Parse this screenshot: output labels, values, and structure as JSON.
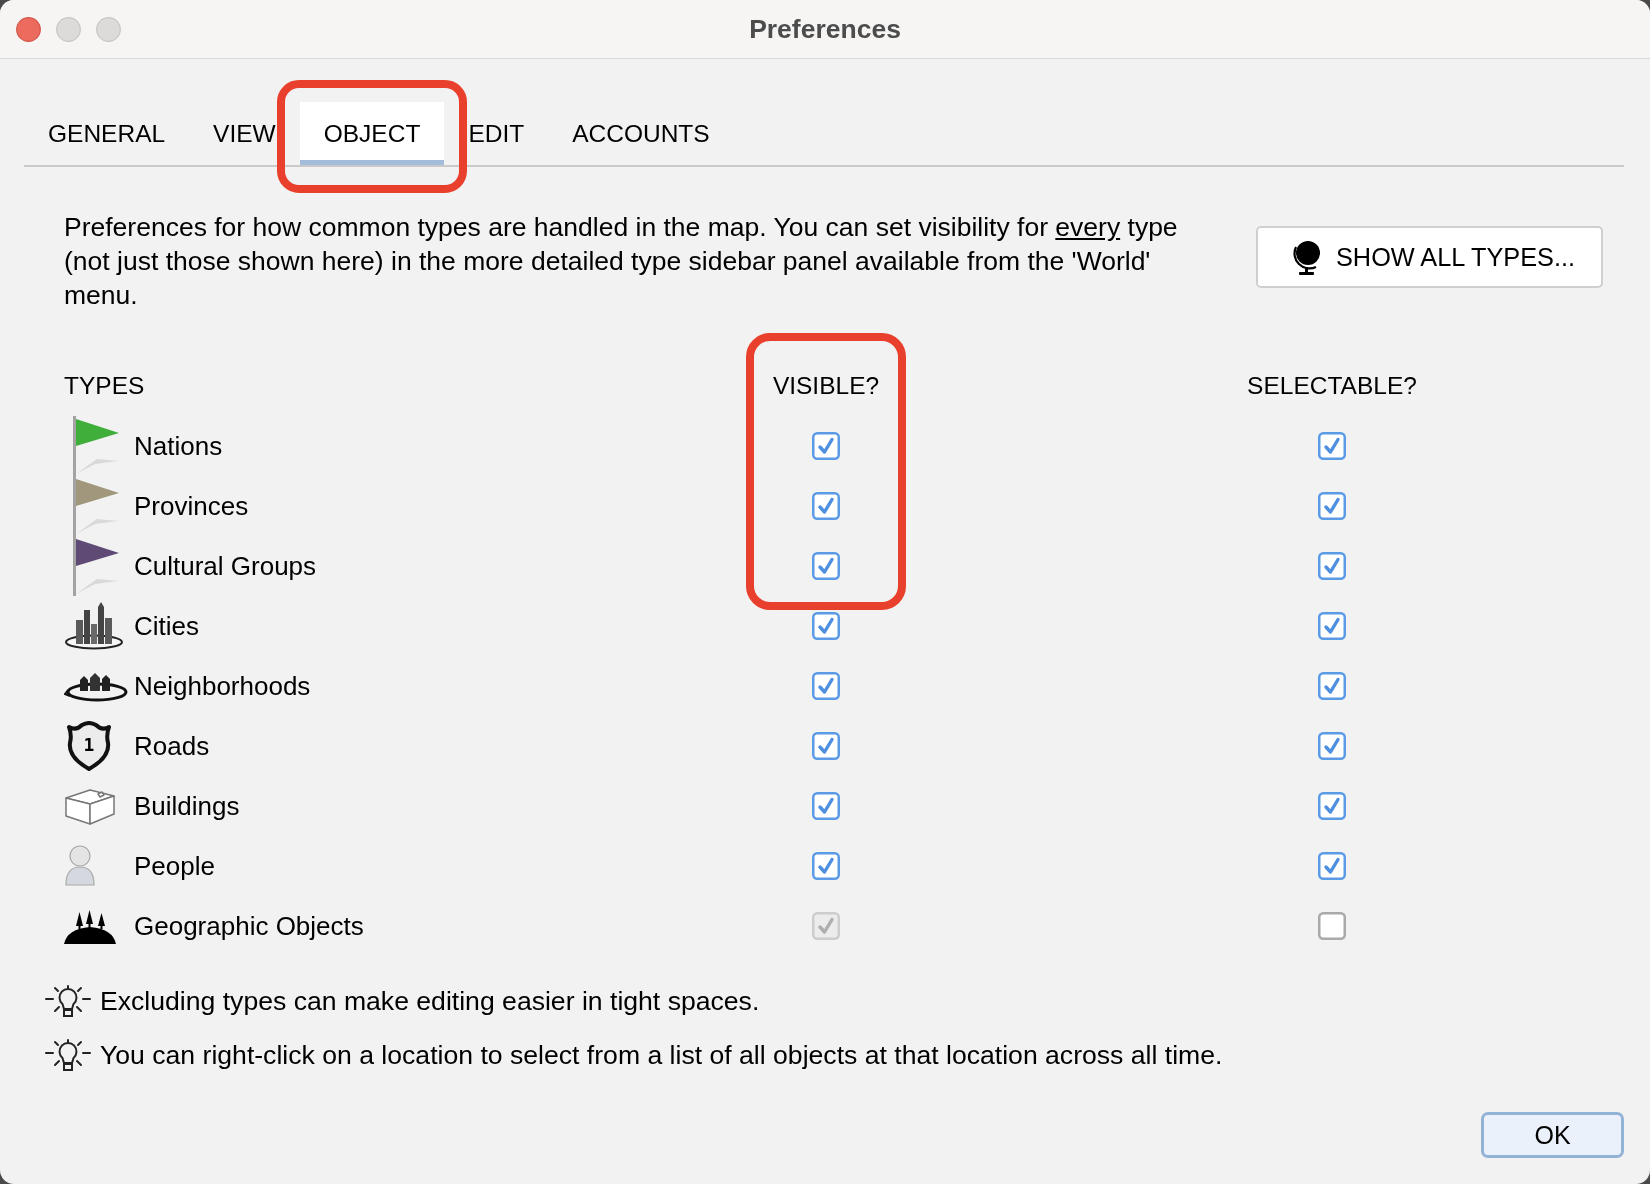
{
  "window": {
    "title": "Preferences",
    "buttons": [
      {
        "kind": "close",
        "disabled": false
      },
      {
        "kind": "minimize",
        "disabled": true
      },
      {
        "kind": "zoom",
        "disabled": true
      }
    ]
  },
  "tabs": [
    {
      "label": "GENERAL",
      "selected": false
    },
    {
      "label": "VIEW",
      "selected": false
    },
    {
      "label": "OBJECT",
      "selected": true,
      "highlighted": true
    },
    {
      "label": "EDIT",
      "selected": false
    },
    {
      "label": "ACCOUNTS",
      "selected": false
    }
  ],
  "description": [
    {
      "text": "Preferences for how common types are handled in the map. You can set visibility for ",
      "underlined": false
    },
    {
      "text": "every",
      "underlined": true
    },
    {
      "text": " type (not just those shown here) in the more detailed type sidebar panel available from the 'World' menu.",
      "underlined": false
    }
  ],
  "show_all_button": {
    "label": "SHOW ALL TYPES..."
  },
  "columns": [
    {
      "label": "TYPES"
    },
    {
      "label": "VISIBLE?",
      "highlighted": true
    },
    {
      "label": "SELECTABLE?"
    }
  ],
  "types": [
    {
      "name": "Nations",
      "kind": "flag",
      "color": "#3fae3a",
      "visible": {
        "checked": true,
        "disabled": false,
        "highlighted": true
      },
      "selectable": {
        "checked": true,
        "disabled": false
      }
    },
    {
      "name": "Provinces",
      "kind": "flag",
      "color": "#a0977c",
      "visible": {
        "checked": true,
        "disabled": false,
        "highlighted": true
      },
      "selectable": {
        "checked": true,
        "disabled": false
      }
    },
    {
      "name": "Cultural Groups",
      "kind": "flag",
      "color": "#5e4a74",
      "visible": {
        "checked": true,
        "disabled": false,
        "highlighted": true
      },
      "selectable": {
        "checked": true,
        "disabled": false
      }
    },
    {
      "name": "Cities",
      "kind": "city",
      "visible": {
        "checked": true,
        "disabled": false
      },
      "selectable": {
        "checked": true,
        "disabled": false
      }
    },
    {
      "name": "Neighborhoods",
      "kind": "neighborhood",
      "visible": {
        "checked": true,
        "disabled": false
      },
      "selectable": {
        "checked": true,
        "disabled": false
      }
    },
    {
      "name": "Roads",
      "kind": "shield",
      "icon_text": "1",
      "visible": {
        "checked": true,
        "disabled": false
      },
      "selectable": {
        "checked": true,
        "disabled": false
      }
    },
    {
      "name": "Buildings",
      "kind": "building",
      "visible": {
        "checked": true,
        "disabled": false
      },
      "selectable": {
        "checked": true,
        "disabled": false
      }
    },
    {
      "name": "People",
      "kind": "person",
      "visible": {
        "checked": true,
        "disabled": false
      },
      "selectable": {
        "checked": true,
        "disabled": false
      }
    },
    {
      "name": "Geographic Objects",
      "kind": "terrain",
      "visible": {
        "checked": true,
        "disabled": true
      },
      "selectable": {
        "checked": false,
        "disabled": false
      }
    }
  ],
  "tips": [
    "Excluding types can make editing easier in tight spaces.",
    "You can right-click on a location to select from a list of all objects at that location across all time."
  ],
  "ok_button": {
    "label": "OK"
  }
}
